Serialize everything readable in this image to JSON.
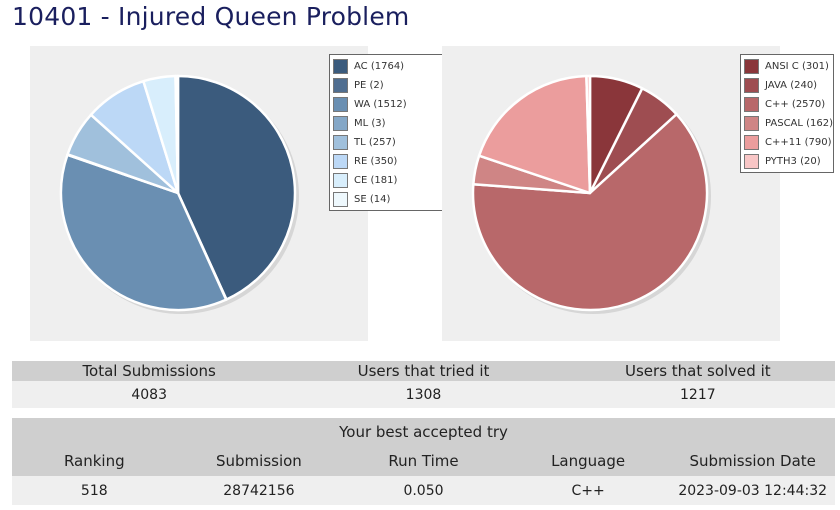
{
  "page_title": "10401 - Injured Queen Problem",
  "chart_data": [
    {
      "type": "pie",
      "title": "",
      "legend_position": "top-right",
      "slices": [
        {
          "label": "AC",
          "value": 1764,
          "color": "#3b5b7d",
          "legend": "AC (1764)"
        },
        {
          "label": "PE",
          "value": 2,
          "color": "#506e90",
          "legend": "PE (2)"
        },
        {
          "label": "WA",
          "value": 1512,
          "color": "#6a8fb2",
          "legend": "WA (1512)"
        },
        {
          "label": "ML",
          "value": 3,
          "color": "#84a7c7",
          "legend": "ML (3)"
        },
        {
          "label": "TL",
          "value": 257,
          "color": "#a0c0dc",
          "legend": "TL (257)"
        },
        {
          "label": "RE",
          "value": 350,
          "color": "#bcd8f6",
          "legend": "RE (350)"
        },
        {
          "label": "CE",
          "value": 181,
          "color": "#d8eefc",
          "legend": "CE (181)"
        },
        {
          "label": "SE",
          "value": 14,
          "color": "#eef8fd",
          "legend": "SE (14)"
        }
      ]
    },
    {
      "type": "pie",
      "title": "",
      "legend_position": "top-right",
      "slices": [
        {
          "label": "ANSI C",
          "value": 301,
          "color": "#8a363a",
          "legend": "ANSI C (301)"
        },
        {
          "label": "JAVA",
          "value": 240,
          "color": "#9e4d51",
          "legend": "JAVA (240)"
        },
        {
          "label": "C++",
          "value": 2570,
          "color": "#b8686a",
          "legend": "C++ (2570)"
        },
        {
          "label": "PASCAL",
          "value": 162,
          "color": "#cf8585",
          "legend": "PASCAL (162)"
        },
        {
          "label": "C++11",
          "value": 790,
          "color": "#eb9d9d",
          "legend": "C++11 (790)"
        },
        {
          "label": "PYTH3",
          "value": 20,
          "color": "#f8c6c6",
          "legend": "PYTH3 (20)"
        }
      ]
    }
  ],
  "stats": {
    "headers": [
      "Total Submissions",
      "Users that tried it",
      "Users that solved it"
    ],
    "values": [
      "4083",
      "1308",
      "1217"
    ]
  },
  "best_try": {
    "caption": "Your best accepted try",
    "headers": [
      "Ranking",
      "Submission",
      "Run Time",
      "Language",
      "Submission Date"
    ],
    "values": [
      "518",
      "28742156",
      "0.050",
      "C++",
      "2023-09-03 12:44:32"
    ]
  }
}
